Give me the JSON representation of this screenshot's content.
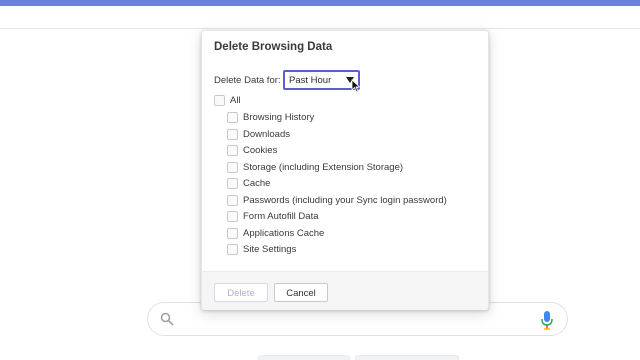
{
  "colors": {
    "accent": "#6b82e4",
    "select_border": "#5a5fd0"
  },
  "dialog": {
    "title": "Delete Browsing Data",
    "period_label": "Delete Data for:",
    "period_value": "Past Hour",
    "all_label": "All",
    "items": [
      {
        "label": "Browsing History",
        "checked": false
      },
      {
        "label": "Downloads",
        "checked": false
      },
      {
        "label": "Cookies",
        "checked": false
      },
      {
        "label": "Storage (including Extension Storage)",
        "checked": false
      },
      {
        "label": "Cache",
        "checked": false
      },
      {
        "label": "Passwords (including your Sync login password)",
        "checked": false
      },
      {
        "label": "Form Autofill Data",
        "checked": false
      },
      {
        "label": "Applications Cache",
        "checked": false
      },
      {
        "label": "Site Settings",
        "checked": false
      }
    ],
    "delete_label": "Delete",
    "delete_disabled": true,
    "cancel_label": "Cancel"
  },
  "search": {
    "icon": "search-icon",
    "mic": "mic-icon"
  }
}
